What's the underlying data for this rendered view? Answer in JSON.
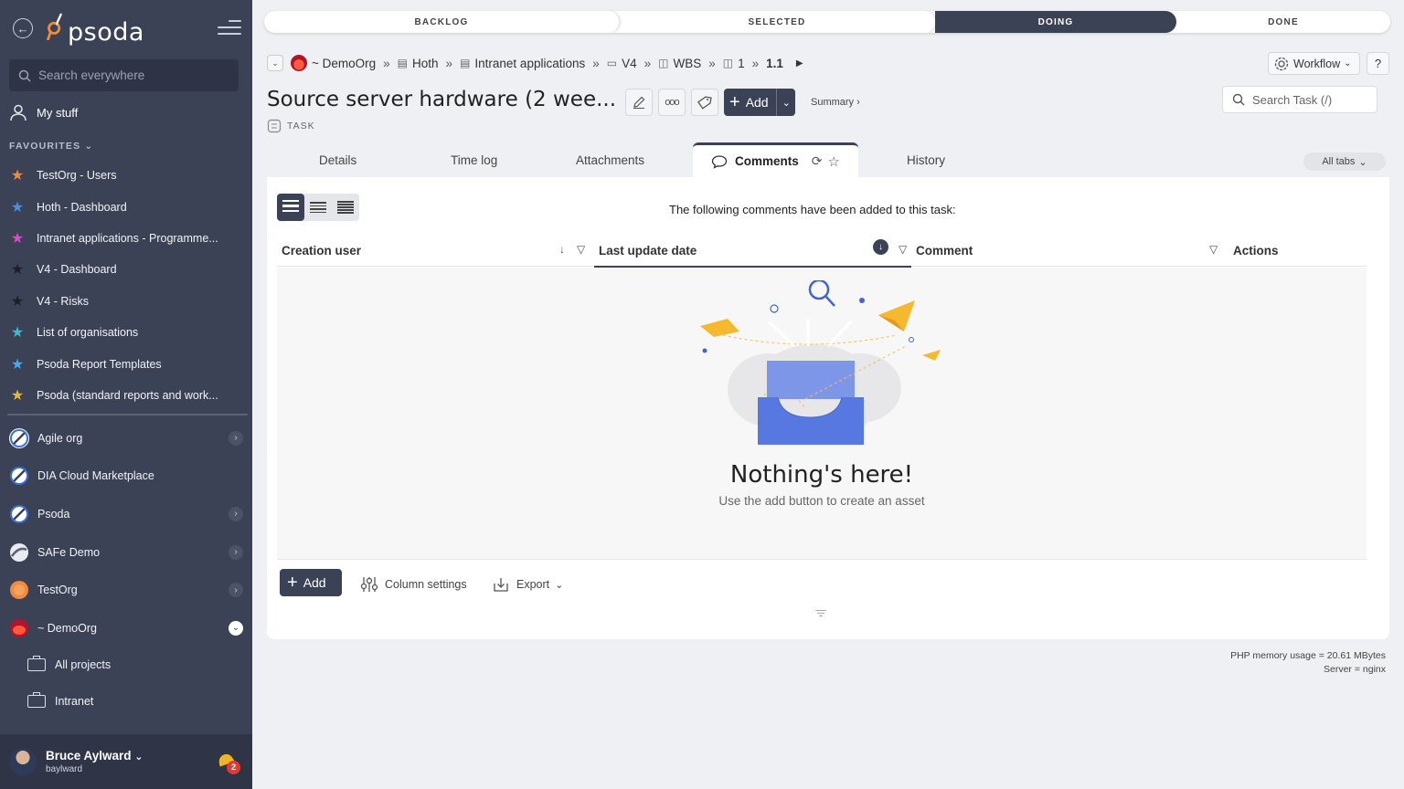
{
  "app": {
    "logo_text": "psoda"
  },
  "sidebar": {
    "search_placeholder": "Search everywhere",
    "my_stuff": "My stuff",
    "favourites_heading": "FAVOURITES",
    "favourites": [
      {
        "label": "TestOrg - Users",
        "color": "#f08a3c"
      },
      {
        "label": "Hoth - Dashboard",
        "color": "#4a8fe0"
      },
      {
        "label": "Intranet applications - Programme...",
        "color": "#d94ad0"
      },
      {
        "label": "V4 - Dashboard",
        "color": "#222222"
      },
      {
        "label": "V4 - Risks",
        "color": "#222222"
      },
      {
        "label": "List of organisations",
        "color": "#3fb8d8"
      },
      {
        "label": "Psoda Report Templates",
        "color": "#4aa8e8"
      },
      {
        "label": "Psoda (standard reports and work...",
        "color": "#e8b830"
      }
    ],
    "orgs": [
      {
        "label": "Agile org",
        "chevron": true
      },
      {
        "label": "DIA Cloud Marketplace",
        "chevron": false
      },
      {
        "label": "Psoda",
        "chevron": true
      },
      {
        "label": "SAFe Demo",
        "chevron": true
      },
      {
        "label": "TestOrg",
        "chevron": true
      },
      {
        "label": "~ DemoOrg",
        "chevron": true
      }
    ],
    "sub_items": [
      "All projects",
      "Intranet"
    ],
    "user": {
      "name": "Bruce Aylward",
      "username": "baylward",
      "notifications": "2"
    }
  },
  "workflow": {
    "steps": [
      "BACKLOG",
      "SELECTED",
      "DOING",
      "DONE"
    ],
    "current": "DOING"
  },
  "breadcrumb": {
    "org": "~ DemoOrg",
    "items": [
      "Hoth",
      "Intranet applications",
      "V4",
      "WBS",
      "1"
    ],
    "current": "1.1"
  },
  "header": {
    "workflow_button": "Workflow",
    "help": "?",
    "title": "Source server hardware (2 wee...",
    "type": "TASK",
    "add_label": "Add",
    "summary": "Summary ›",
    "search_placeholder": "Search Task (/)"
  },
  "tabs": {
    "items": [
      "Details",
      "Time log",
      "Attachments",
      "Comments",
      "History"
    ],
    "active": "Comments",
    "all_tabs": "All tabs"
  },
  "comments": {
    "intro": "The following comments have been added to this task:",
    "columns": [
      "Creation user",
      "Last update date",
      "Comment",
      "Actions"
    ],
    "sorted_column": "Last update date",
    "empty_title": "Nothing's here!",
    "empty_sub": "Use the add button to create an asset",
    "footer": {
      "add": "Add",
      "column_settings": "Column settings",
      "export": "Export"
    }
  },
  "footer": {
    "memory": "PHP memory usage = 20.61 MBytes",
    "server": "Server = nginx"
  }
}
